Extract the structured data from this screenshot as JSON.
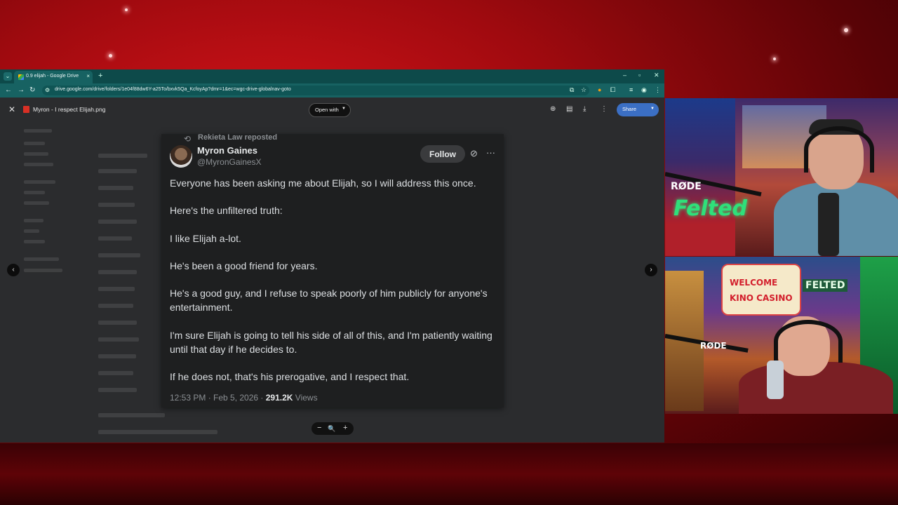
{
  "browser": {
    "tab_title": "0.9 elijah - Google Drive",
    "tab_close": "×",
    "new_tab": "+",
    "url": "drive.google.com/drive/folders/1e04f88dw6Y-a25To/bxvk5Qa_KcfoyAp?dmr=1&ec=wgc-drive-globalnav-goto"
  },
  "viewer": {
    "file_name": "Myron - I respect Elijah.png",
    "open_with": "Open with",
    "share": "Share",
    "zoom_out": "−",
    "zoom_icon": "🔍",
    "zoom_in": "+"
  },
  "tweet": {
    "reposted_by": "Rekieta Law reposted",
    "name": "Myron Gaines",
    "handle": "@MyronGainesX",
    "follow": "Follow",
    "paragraphs": [
      "Everyone has been asking me about Elijah, so I will address this once.",
      "Here's the unfiltered truth:",
      "I like Elijah a-lot.",
      "He's been a good friend for years.",
      "He's a good guy, and I refuse to speak poorly of him publicly for anyone's entertainment.",
      "I'm sure Elijah is going to tell his side of all of this, and I'm patiently waiting until that day if he decides to.",
      "If he does not, that's his prerogative, and I respect that."
    ],
    "time": "12:53 PM · Feb 5, 2026 · ",
    "views_count": "291.2K",
    "views_label": " Views"
  },
  "webcams": {
    "cam1_mic_brand": "RØDE",
    "cam1_sign": "Felted",
    "cam2_sign_welcome": "WELCOME",
    "cam2_sign_kino": "KINO CASINO",
    "cam2_sign_felted": "FELTED",
    "cam2_mic_brand": "RØDE"
  }
}
